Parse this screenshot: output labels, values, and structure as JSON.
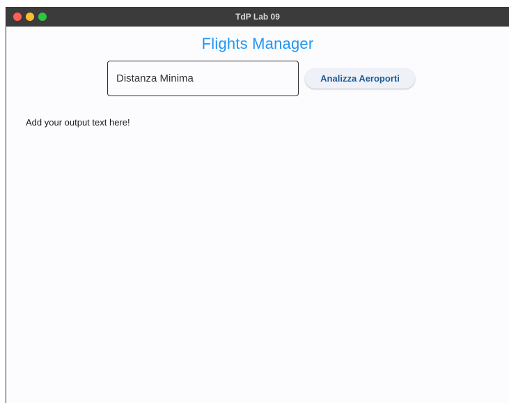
{
  "window": {
    "title": "TdP Lab 09"
  },
  "app": {
    "title": "Flights Manager"
  },
  "form": {
    "min_distance_placeholder": "Distanza Minima",
    "analyze_button_label": "Analizza Aeroporti"
  },
  "output": {
    "text": "Add your output text here!"
  },
  "colors": {
    "accent": "#2196f3",
    "button_text": "#1e5a96",
    "titlebar": "#3b3b3b"
  }
}
